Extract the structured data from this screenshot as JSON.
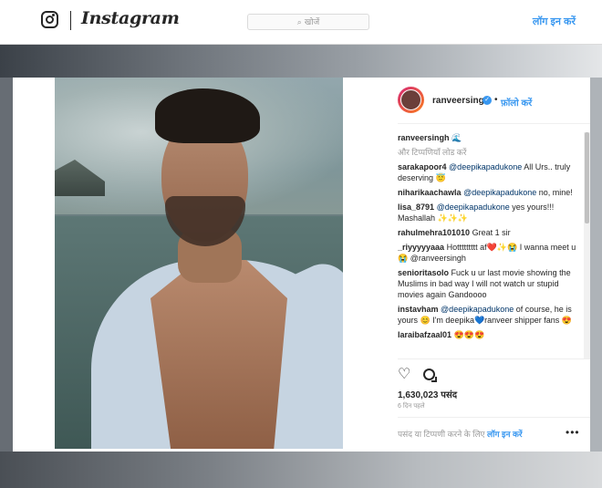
{
  "header": {
    "wordmark": "Instagram",
    "search_placeholder": "खोजें",
    "login_label": "लॉग इन करें"
  },
  "post": {
    "owner": "ranveersingh",
    "verified_icon": "✓",
    "separator": "•",
    "follow_label": "फ़ॉलो करें",
    "caption_user": "ranveersingh",
    "caption_emoji": "🌊",
    "load_more": "और टिप्पणियाँ लोड करें",
    "comments": [
      {
        "user": "sarakapoor4",
        "mention": "@deepikapadukone",
        "text": " All Urs.. truly deserving 😇"
      },
      {
        "user": "niharikaachawla",
        "mention": "@deepikapadukone",
        "text": " no, mine!"
      },
      {
        "user": "lisa_8791",
        "mention": "@deepikapadukone",
        "text": " yes yours!!! Mashallah ✨✨✨"
      },
      {
        "user": "rahulmehra101010",
        "mention": "",
        "text": "Great 1 sir"
      },
      {
        "user": "_riyyyyyaaa",
        "mention": "",
        "text": "Hottttttttt af❤️✨😭 I wanna meet u 😭 @ranveersingh"
      },
      {
        "user": "senioritasolo",
        "mention": "",
        "text": "Fuck u ur last movie showing the Muslims in bad way I will not watch ur stupid movies again Gandoooo"
      },
      {
        "user": "instavham",
        "mention": "@deepikapadukone",
        "text": " of course, he is yours 😊 I'm deepika💙ranveer shipper fans 😍"
      },
      {
        "user": "laraibafzaal01",
        "mention": "",
        "text": "😍😍😍"
      }
    ],
    "likes": "1,630,023 पसंद",
    "time": "6 दिन पहले",
    "add_comment_prefix": "पसंद या टिप्पणी करने के लिए ",
    "add_comment_login": "लॉग इन करें",
    "more_icon": "•••"
  }
}
